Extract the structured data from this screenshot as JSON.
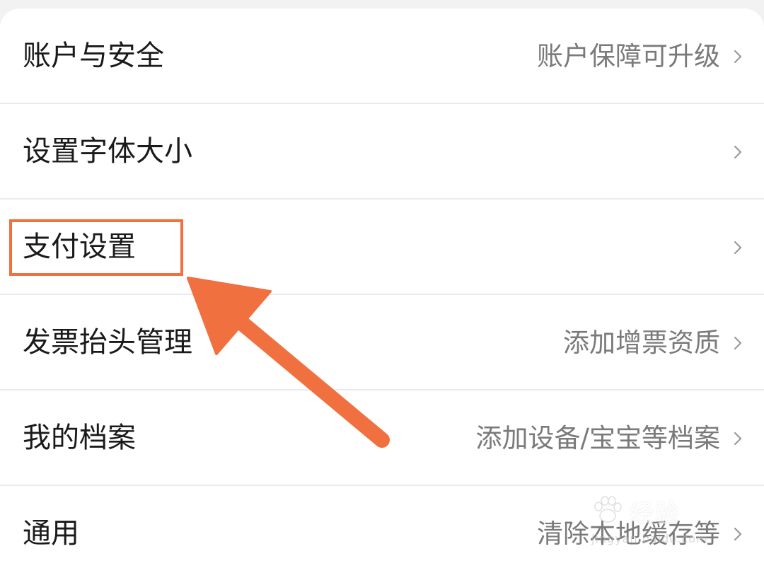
{
  "settings": {
    "items": [
      {
        "label": "账户与安全",
        "value": "账户保障可升级"
      },
      {
        "label": "设置字体大小",
        "value": ""
      },
      {
        "label": "支付设置",
        "value": ""
      },
      {
        "label": "发票抬头管理",
        "value": "添加增票资质"
      },
      {
        "label": "我的档案",
        "value": "添加设备/宝宝等档案"
      },
      {
        "label": "通用",
        "value": "清除本地缓存等"
      }
    ]
  },
  "annotation": {
    "highlight_color": "#f07040",
    "arrow_color": "#f07040"
  },
  "watermark": {
    "text": "经验",
    "url": "jingyan.baidu.com"
  },
  "colors": {
    "background": "#f2f2f2",
    "card": "#ffffff",
    "label_text": "#1a1a1a",
    "value_text": "#7a7a7a",
    "divider": "#ebebeb"
  }
}
